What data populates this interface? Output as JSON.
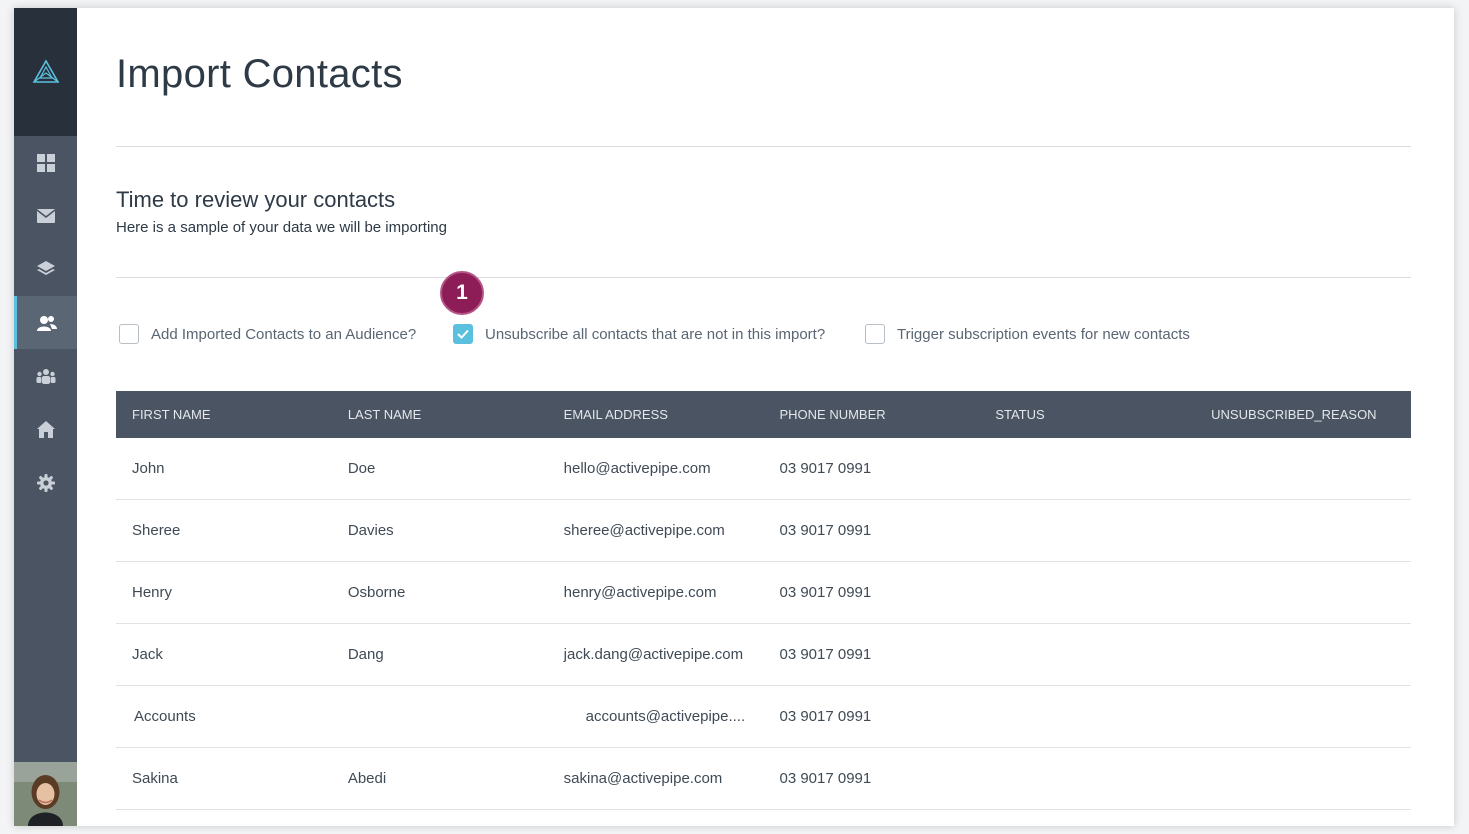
{
  "page": {
    "title": "Import Contacts",
    "section_title": "Time to review your contacts",
    "section_subtitle": "Here is a sample of your data we will be importing",
    "step_badge": "1"
  },
  "sidebar": {
    "logo": "triangle-logo-icon",
    "items": [
      {
        "icon": "dashboard-grid-icon",
        "active": false
      },
      {
        "icon": "envelope-icon",
        "active": false
      },
      {
        "icon": "layers-icon",
        "active": false
      },
      {
        "icon": "contacts-icon",
        "active": true
      },
      {
        "icon": "group-icon",
        "active": false
      },
      {
        "icon": "home-icon",
        "active": false
      },
      {
        "icon": "gear-icon",
        "active": false
      }
    ]
  },
  "options": [
    {
      "label": "Add Imported Contacts to an Audience?",
      "checked": false
    },
    {
      "label": "Unsubscribe all contacts that are not in this import?",
      "checked": true
    },
    {
      "label": "Trigger subscription events for new contacts",
      "checked": false
    }
  ],
  "table": {
    "headers": [
      "FIRST NAME",
      "LAST NAME",
      "EMAIL ADDRESS",
      "PHONE NUMBER",
      "STATUS",
      "UNSUBSCRIBED_REASON"
    ],
    "rows": [
      [
        "John",
        "Doe",
        "hello@activepipe.com",
        "03 9017 0991",
        "",
        ""
      ],
      [
        "Sheree",
        "Davies",
        "sheree@activepipe.com",
        "03 9017 0991",
        "",
        ""
      ],
      [
        "Henry",
        "Osborne",
        "henry@activepipe.com",
        "03 9017 0991",
        "",
        ""
      ],
      [
        "Jack",
        "Dang",
        "jack.dang@activepipe.com",
        "03 9017 0991",
        "",
        ""
      ],
      [
        "Accounts",
        "",
        "accounts@activepipe....",
        "03 9017 0991",
        "",
        ""
      ],
      [
        "Sakina",
        "Abedi",
        "sakina@activepipe.com",
        "03 9017 0991",
        "",
        ""
      ]
    ]
  },
  "colors": {
    "sidebar": "#4a5463",
    "sidebar_top": "#27303b",
    "accent": "#5bc0de",
    "badge": "#8c1d56"
  }
}
